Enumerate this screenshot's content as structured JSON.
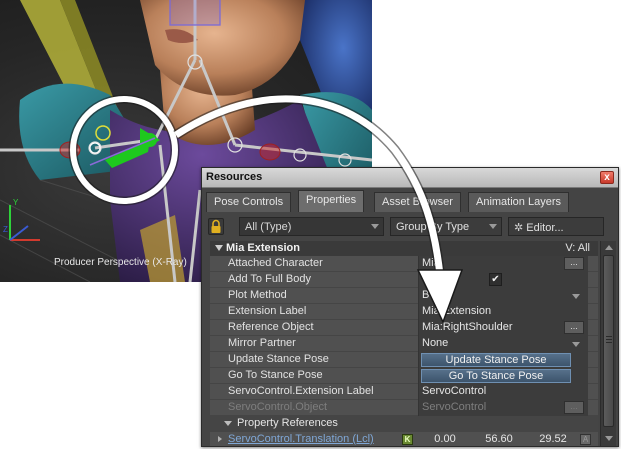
{
  "viewport": {
    "label": "Producer Perspective (X-Ray)",
    "axis_labels": {
      "y": "Y",
      "z": "Z"
    }
  },
  "panel": {
    "title": "Resources",
    "close_label": "x",
    "tabs": [
      {
        "label": "Pose Controls",
        "active": false
      },
      {
        "label": "Properties",
        "active": true
      },
      {
        "label": "Asset Browser",
        "active": false
      },
      {
        "label": "Animation Layers",
        "active": false
      }
    ],
    "toolbar": {
      "type_filter": "All (Type)",
      "group_by": "Group By Type",
      "editor": "Editor..."
    },
    "header": {
      "label": "Mia Extension",
      "filter": "V: All"
    },
    "rows": [
      {
        "name": "Attached Character",
        "value": "Mia"
      },
      {
        "name": "Add To Full Body",
        "checked": true
      },
      {
        "name": "Plot Method",
        "value": "Body"
      },
      {
        "name": "Extension Label",
        "value": "Mia Extension"
      },
      {
        "name": "Reference Object",
        "value": "Mia:RightShoulder"
      },
      {
        "name": "Mirror Partner",
        "value": "None"
      },
      {
        "name": "Update Stance Pose",
        "button": "Update Stance Pose"
      },
      {
        "name": "Go To Stance Pose",
        "button": "Go To Stance Pose"
      },
      {
        "name": "ServoControl.Extension Label",
        "value": "ServoControl"
      },
      {
        "name": "ServoControl.Object",
        "value": "ServoControl"
      }
    ],
    "subheader": "Property References",
    "reference": {
      "name": "ServoControl.Translation (Lcl)",
      "key": "K",
      "x": "0.00",
      "y": "56.60",
      "z": "29.52",
      "anim": "A"
    },
    "ellipsis": "..."
  },
  "colors": {
    "panel_bg": "#444444",
    "highlight_ring": "#ffffff",
    "gizmo_green": "#1ec81e"
  }
}
